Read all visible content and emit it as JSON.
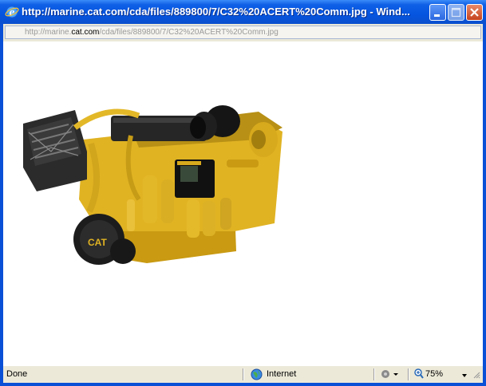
{
  "window": {
    "title": "http://marine.cat.com/cda/files/889800/7/C32%20ACERT%20Comm.jpg - Wind..."
  },
  "address": {
    "prefix": "http://marine.",
    "domain": "cat.com",
    "path": "/cda/files/889800/7/C32%20ACERT%20Comm.jpg"
  },
  "image": {
    "badge_text": "CAT"
  },
  "status": {
    "left": "Done",
    "zone": "Internet",
    "zoom": "75%"
  },
  "icons": {
    "app": "ie-icon",
    "minimize": "minimize-icon",
    "maximize": "maximize-icon",
    "close": "close-icon",
    "zone": "globe-icon",
    "protected": "protected-mode-icon",
    "zoom": "zoom-icon"
  },
  "colors": {
    "titlebar": "#0655e0",
    "engine_body": "#e0b323",
    "engine_dark": "#1c1c1c"
  }
}
